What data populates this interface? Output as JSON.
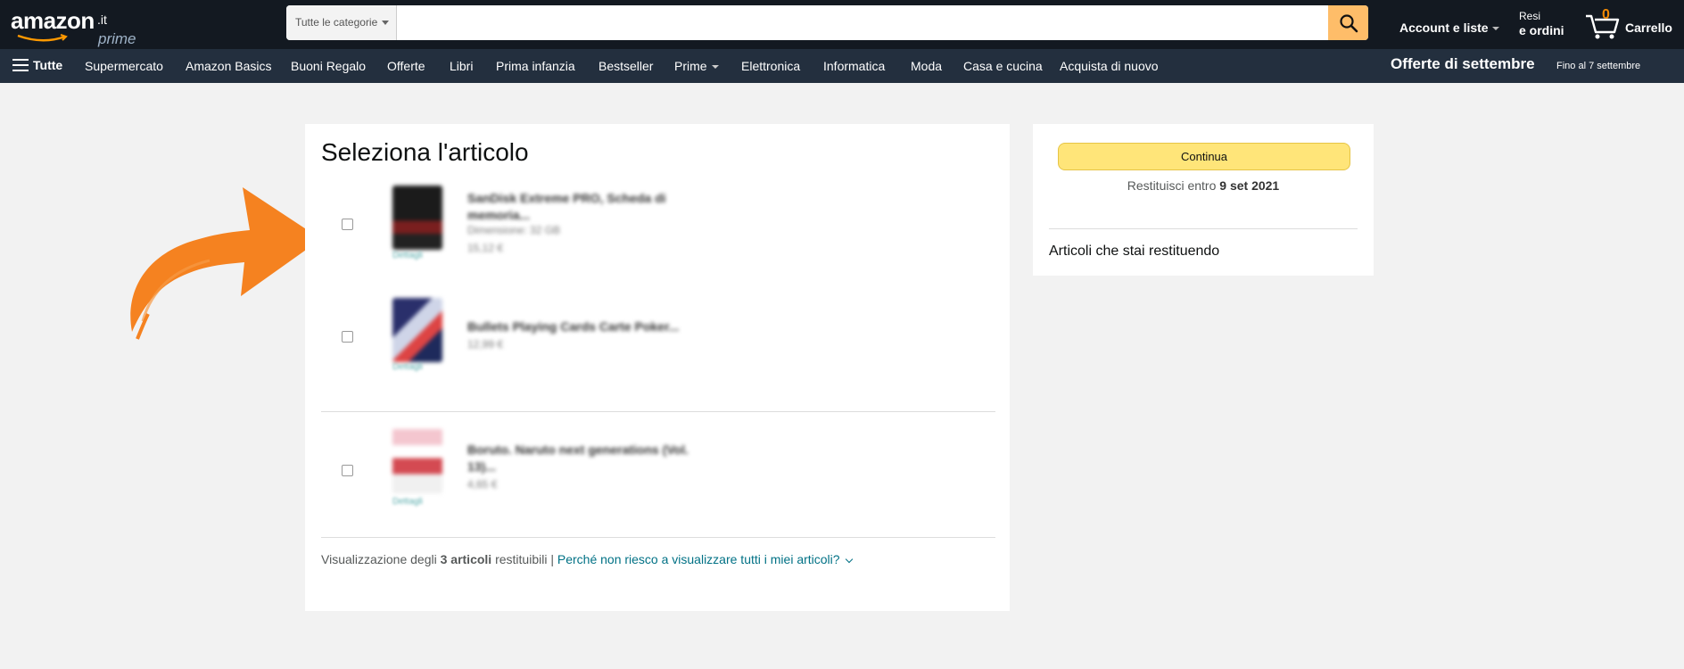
{
  "header": {
    "logo": {
      "brand": "amazon",
      "tld": ".it",
      "sub": "prime"
    },
    "search": {
      "category": "Tutte le categorie",
      "placeholder": "",
      "value": ""
    },
    "account_label": "Account e liste",
    "returns": {
      "line1": "Resi",
      "line2": "e ordini"
    },
    "cart": {
      "count": "0",
      "label": "Carrello"
    }
  },
  "subnav": {
    "all_label": "Tutte",
    "items": [
      "Supermercato",
      "Amazon Basics",
      "Buoni Regalo",
      "Offerte",
      "Libri",
      "Prima infanzia",
      "Bestseller",
      "Prime",
      "Elettronica",
      "Informatica",
      "Moda",
      "Casa e cucina",
      "Acquista di nuovo"
    ],
    "promo_title": "Offerte di settembre",
    "promo_sub": "Fino al 7 settembre"
  },
  "main": {
    "title": "Seleziona l'articolo",
    "items": [
      {
        "title": "SanDisk Extreme PRO, Scheda di memoria...",
        "size": "Dimensione: 32 GB",
        "price": "15,12 €",
        "details": "Dettagli"
      },
      {
        "title": "Bullets Playing Cards Carte Poker...",
        "price": "12,99 €",
        "details": "Dettagli"
      },
      {
        "title": "Boruto. Naruto next generations (Vol. 13)...",
        "price": "4,65 €",
        "details": "Dettagli"
      }
    ],
    "footnote": {
      "prefix": "Visualizzazione degli",
      "count": "3 articoli",
      "suffix": "restituibili |",
      "link": "Perché non riesco a visualizzare tutti i miei articoli?"
    }
  },
  "side": {
    "continue_label": "Continua",
    "return_prefix": "Restituisci entro",
    "return_date": "9 set 2021",
    "heading": "Articoli che stai restituendo"
  },
  "colors": {
    "topbar": "#131921",
    "subnav": "#232f3e",
    "search_button": "#febd69",
    "continue_button": "#ffe579",
    "link": "#007185",
    "arrow": "#f58220"
  }
}
